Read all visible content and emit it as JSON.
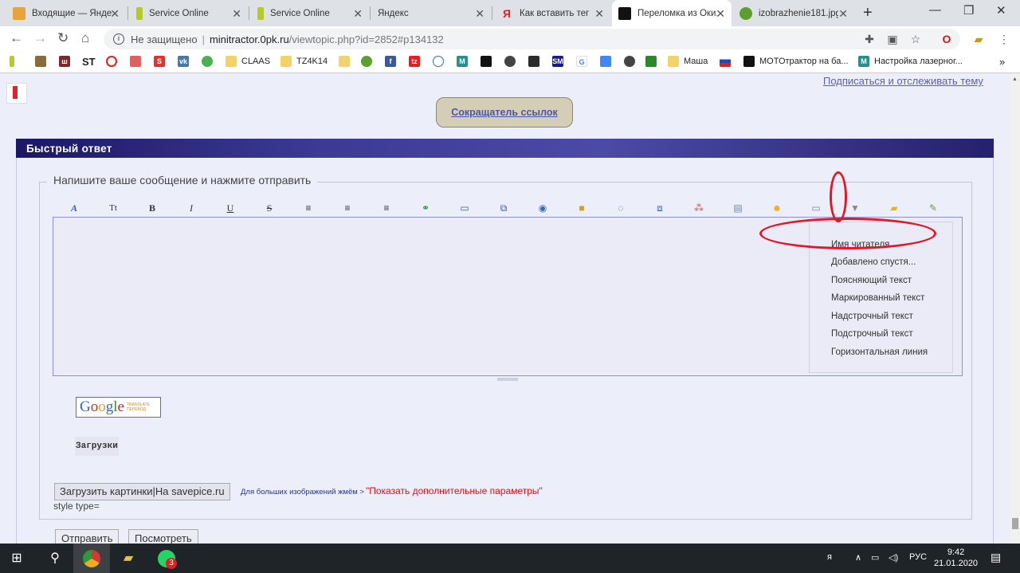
{
  "tabs": [
    {
      "label": "Входящие — Яндекс.Почта",
      "color": "#e8a33a"
    },
    {
      "label": "Service Online",
      "color": "#b6c92a"
    },
    {
      "label": "Service Online",
      "color": "#b6c92a"
    },
    {
      "label": "Яндекс",
      "color": "#ffffff"
    },
    {
      "label": "Как вставить тег кто",
      "color": "#e02020"
    },
    {
      "label": "Переломка из Оки.",
      "color": "#111111"
    },
    {
      "label": "izobrazhenie181.jpg",
      "color": "#5aa02c"
    }
  ],
  "address": {
    "security": "Не защищено",
    "host": "minitractor.0pk.ru",
    "path": "/viewtopic.php?id=2852#p134132"
  },
  "bookmarks": [
    {
      "label": "CLAAS",
      "color": "#f2d36b"
    },
    {
      "label": "TZ4K14",
      "color": "#f2d36b"
    },
    {
      "label": "Маша",
      "color": "#f2d36b"
    },
    {
      "label": "МОТОтрактор на ба...",
      "color": "#111111"
    },
    {
      "label": "Настройка лазерног...",
      "color": "#2a8f8a"
    }
  ],
  "bookmark_icons": [
    "ST"
  ],
  "page": {
    "subscribe_link": "Подписаться и отслеживать тему",
    "shortener_button": "Сокращатель ссылок",
    "quick_reply_title": "Быстрый ответ",
    "legend": "Напишите ваше сообщение и нажмите отправить",
    "dropdown_items": [
      "Имя читателя",
      "Добавлено спустя...",
      "Поясняющий текст",
      "Маркированный текст",
      "Надстрочный текст",
      "Подстрочный текст",
      "Горизонтальная линия"
    ],
    "google_word": "Google",
    "google_sub": "TRANSLATE\nПЕРЕВОД",
    "uploads_label": "Загрузки",
    "upload_button": "Загрузить картинки|На savepice.ru",
    "large_hint": "Для больших изображений жмём >",
    "show_params": "\"Показать дополнительные параметры\"",
    "style_type": "style type=",
    "submit_button": "Отправить",
    "preview_button": "Посмотреть"
  },
  "editor_tools": [
    "font-icon",
    "text-size-icon",
    "bold-icon",
    "italic-icon",
    "underline-icon",
    "strike-icon",
    "align-left-icon",
    "align-center-icon",
    "align-right-icon",
    "link-icon",
    "book-icon",
    "image-icon",
    "video-icon",
    "lock-icon",
    "quote-icon",
    "code-icon",
    "color-icon",
    "table-icon",
    "smile-icon",
    "keyboard-icon",
    "more-dropdown-icon",
    "folder-icon",
    "edit-icon"
  ],
  "editor_glyphs": [
    "A",
    "Tt",
    "B",
    "I",
    "U",
    "S"
  ],
  "taskbar": {
    "language": "РУС",
    "time": "9:42",
    "date": "21.01.2020",
    "whatsapp_badge": "3"
  },
  "colors": {
    "header_gradient": "#3b3995",
    "annotation_red": "#e01828",
    "link_blue": "#5a5fb0"
  }
}
